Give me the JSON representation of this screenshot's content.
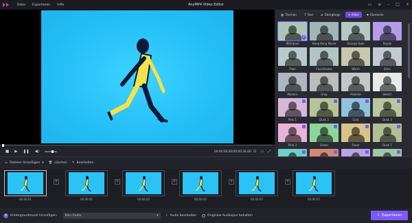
{
  "app": {
    "title": "AnyMP4 Video Editor"
  },
  "menu": {
    "file": "Datei",
    "export": "Exportieren",
    "help": "Hilfe"
  },
  "tabs": [
    {
      "label": "Themen",
      "icon": "themes-icon"
    },
    {
      "label": "Text",
      "icon": "text-icon"
    },
    {
      "label": "Übergänge",
      "icon": "transitions-icon"
    },
    {
      "label": "Filter",
      "icon": "filter-icon",
      "active": true
    },
    {
      "label": "Elements",
      "icon": "elements-icon"
    }
  ],
  "filters": [
    {
      "name": "Whirlpool",
      "color": "#a9c6b8",
      "selected": true
    },
    {
      "name": "Hong Kong Movie",
      "color": "#9fb6b6"
    },
    {
      "name": "Orange Dots",
      "color": "#b4c8c6"
    },
    {
      "name": "Purple",
      "color": "#b29ee8"
    },
    {
      "name": "Plain",
      "color": "#b7c9cc"
    },
    {
      "name": "Coordinates",
      "color": "#b0c6c4"
    },
    {
      "name": "Warm",
      "color": "#c6c8b0"
    },
    {
      "name": "Stars",
      "color": "#c2cbd2"
    },
    {
      "name": "Modern",
      "color": "#aeb7bf"
    },
    {
      "name": "Gray",
      "color": "#bcbcbc"
    },
    {
      "name": "Pixelate",
      "color": "#c4c7c7"
    },
    {
      "name": "Sketch",
      "color": "#e9e9e9"
    },
    {
      "name": "Pink 1",
      "color": "#d6b9d9",
      "locked": true
    },
    {
      "name": "Dusk 2",
      "color": "#b5c59a",
      "locked": true
    },
    {
      "name": "Cool",
      "color": "#93c2dc",
      "locked": true
    },
    {
      "name": "Dusk 3",
      "color": "#b8c79e",
      "locked": true
    },
    {
      "name": "Pink 3",
      "color": "#e7b3d6",
      "locked": true
    },
    {
      "name": "Green",
      "color": "#8fd49a",
      "locked": true
    },
    {
      "name": "Fever",
      "color": "#d7c48a",
      "locked": true
    },
    {
      "name": "Dusk 1",
      "color": "#b1bf95",
      "locked": true
    },
    {
      "name": "",
      "color": "#6fd0c8",
      "locked": true
    },
    {
      "name": "",
      "color": "#d08a7a",
      "locked": true
    },
    {
      "name": "",
      "color": "#b6a6e8",
      "locked": true
    },
    {
      "name": "",
      "color": "#9ec7a8",
      "locked": true
    }
  ],
  "player": {
    "time": "00:00:00.00/00:00:26.00"
  },
  "toolbar": {
    "add_files": "Dateien hinzufügen",
    "delete": "Löschen",
    "edit": "Bearbeiten"
  },
  "clips": [
    {
      "duration": "00:00:01",
      "active": true
    },
    {
      "duration": "00:00:05"
    },
    {
      "duration": "00:00:05"
    },
    {
      "duration": "00:00:05"
    },
    {
      "duration": "00:00:05"
    },
    {
      "duration": "00:00:05"
    }
  ],
  "bottom": {
    "add_music": "Hintergrundmusik hinzufügen:",
    "audio_value": "Kein Audio",
    "edit_audio": "Audio bearbeiten",
    "keep_audio": "Originale Audiospur behalten",
    "export": "Exportieren"
  },
  "colors": {
    "accent": "#7a5af5",
    "video_bg": "#23bff7"
  }
}
